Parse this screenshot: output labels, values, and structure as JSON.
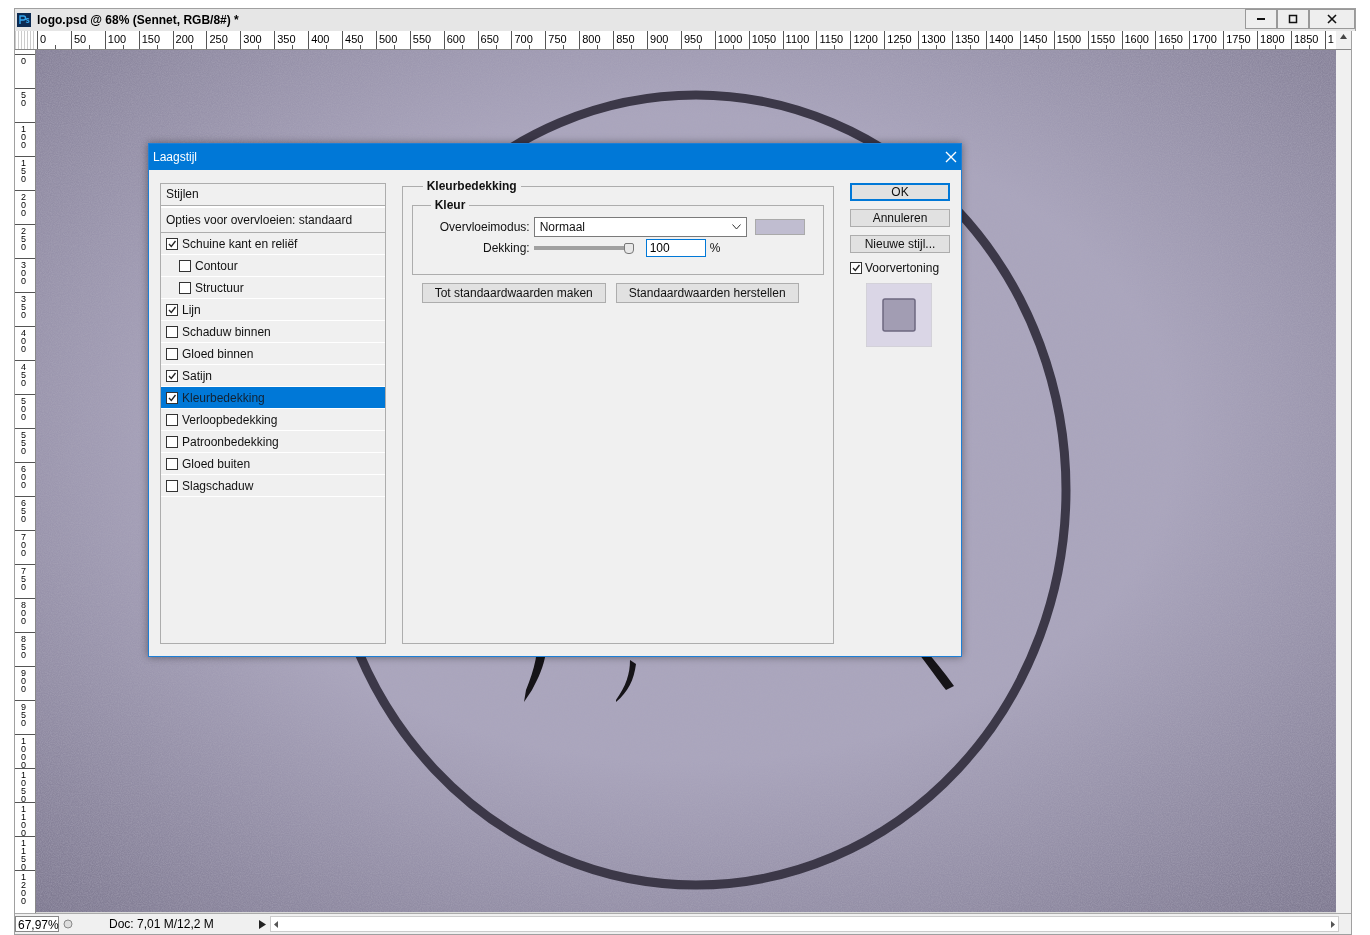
{
  "window": {
    "title": "logo.psd @ 68% (Sennet, RGB/8#) *"
  },
  "rulers": {
    "horizontal": [
      "0",
      "50",
      "100",
      "150",
      "200",
      "250",
      "300",
      "350",
      "400",
      "450",
      "500",
      "550",
      "600",
      "650",
      "700",
      "750",
      "800",
      "850",
      "900",
      "950",
      "1000",
      "1050",
      "1100",
      "1150",
      "1200",
      "1250",
      "1300",
      "1350",
      "1400",
      "1450",
      "1500",
      "1550",
      "1600",
      "1650",
      "1700",
      "1750",
      "1800",
      "1850",
      "1"
    ],
    "vertical": [
      "0",
      "50",
      "100",
      "150",
      "200",
      "250",
      "300",
      "350",
      "400",
      "450",
      "500",
      "550",
      "600",
      "650",
      "700",
      "750",
      "800",
      "850",
      "900",
      "950",
      "1000",
      "1050",
      "1100",
      "1150",
      "1200"
    ]
  },
  "dialog": {
    "title": "Laagstijl",
    "styles": {
      "header": "Stijlen",
      "items": [
        {
          "label": "Opties voor overvloeien: standaard",
          "kind": "plain",
          "selected": false
        },
        {
          "label": "Schuine kant en reliëf",
          "kind": "check",
          "checked": true,
          "selected": false,
          "children": [
            {
              "label": "Contour",
              "kind": "check",
              "checked": false,
              "selected": false
            },
            {
              "label": "Structuur",
              "kind": "check",
              "checked": false,
              "selected": false
            }
          ]
        },
        {
          "label": "Lijn",
          "kind": "check",
          "checked": true,
          "selected": false
        },
        {
          "label": "Schaduw binnen",
          "kind": "check",
          "checked": false,
          "selected": false
        },
        {
          "label": "Gloed binnen",
          "kind": "check",
          "checked": false,
          "selected": false
        },
        {
          "label": "Satijn",
          "kind": "check",
          "checked": true,
          "selected": false
        },
        {
          "label": "Kleurbedekking",
          "kind": "check",
          "checked": true,
          "selected": true
        },
        {
          "label": "Verloopbedekking",
          "kind": "check",
          "checked": false,
          "selected": false
        },
        {
          "label": "Patroonbedekking",
          "kind": "check",
          "checked": false,
          "selected": false
        },
        {
          "label": "Gloed buiten",
          "kind": "check",
          "checked": false,
          "selected": false
        },
        {
          "label": "Slagschaduw",
          "kind": "check",
          "checked": false,
          "selected": false
        }
      ]
    },
    "section": {
      "title": "Kleurbedekking",
      "group": "Kleur",
      "blend_mode": {
        "label": "Overvloeimodus:",
        "value": "Normaal",
        "color": "#c0bdd0"
      },
      "opacity": {
        "label": "Dekking:",
        "level": 1,
        "value": "100",
        "unit": "%"
      },
      "buttons": [
        "Tot standaardwaarden maken",
        "Standaardwaarden herstellen"
      ]
    },
    "actions": [
      {
        "label": "OK",
        "default": true
      },
      {
        "label": "Annuleren",
        "default": false
      },
      {
        "label": "Nieuwe stijl...",
        "default": false
      }
    ],
    "preview": {
      "label": "Voorvertoning",
      "checked": true
    }
  },
  "status_bar": {
    "zoom": "67,97%",
    "document": "Doc: 7,01 M/12,2 M"
  }
}
